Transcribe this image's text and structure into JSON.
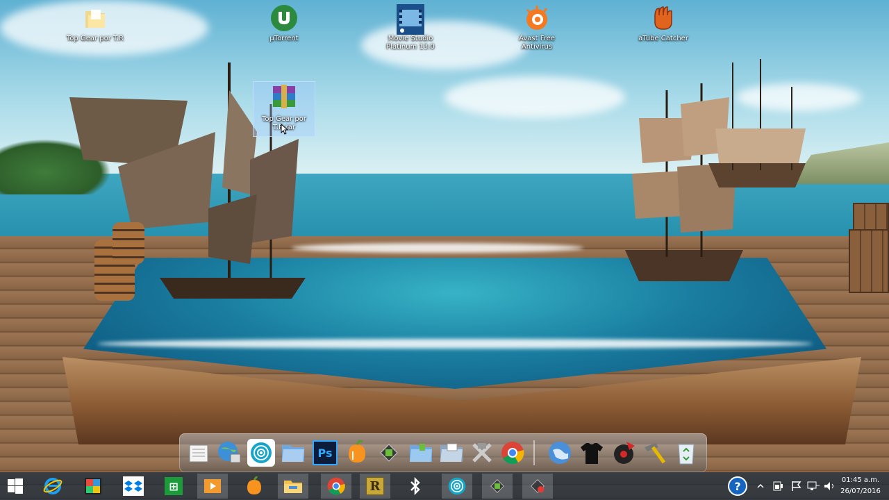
{
  "desktop": {
    "icons": [
      {
        "label": "Top Gear por T.R",
        "icon": "folder-icon"
      },
      {
        "label": "µTorrent",
        "icon": "utorrent-icon"
      },
      {
        "label": "Movie Studio Platinum 13.0",
        "icon": "movie-studio-icon"
      },
      {
        "label": "Avast Free Antivirus",
        "icon": "avast-icon"
      },
      {
        "label": "aTube Catcher",
        "icon": "atube-catcher-icon"
      },
      {
        "label": "Top Gear por T.R.rar",
        "icon": "winrar-archive-icon"
      }
    ]
  },
  "dock": {
    "items": [
      "notepad-icon",
      "network-globe-icon",
      "media-wifi-icon",
      "folder-blue-icon",
      "photoshop-icon",
      "fl-studio-icon",
      "camtasia-icon",
      "folder-green-icon",
      "folder-grey-icon",
      "tools-icon",
      "chrome-icon",
      "globe-icon",
      "tshirt-icon",
      "vinyl-icon",
      "hammer-icon",
      "recycle-bin-icon"
    ],
    "photoshop_label": "Ps"
  },
  "taskbar": {
    "items": [
      "start-icon",
      "internet-explorer-icon",
      "app-store-icon",
      "dropbox-icon",
      "windows-store-icon",
      "media-player-icon",
      "fl-studio-icon",
      "file-explorer-icon",
      "chrome-icon",
      "r-app-icon",
      "bluetooth-icon",
      "media-wifi-icon",
      "camtasia-icon",
      "recorder-icon"
    ],
    "store_label": "⊞",
    "r_label": "R",
    "help_label": "?",
    "tray": [
      "chevron-up-icon",
      "battery-icon",
      "flag-icon",
      "network-icon",
      "volume-icon"
    ],
    "time": "01:45 a.m.",
    "date": "26/07/2016"
  },
  "colors": {
    "taskbar_bg": "#142838",
    "accent": "#1e88e5"
  }
}
